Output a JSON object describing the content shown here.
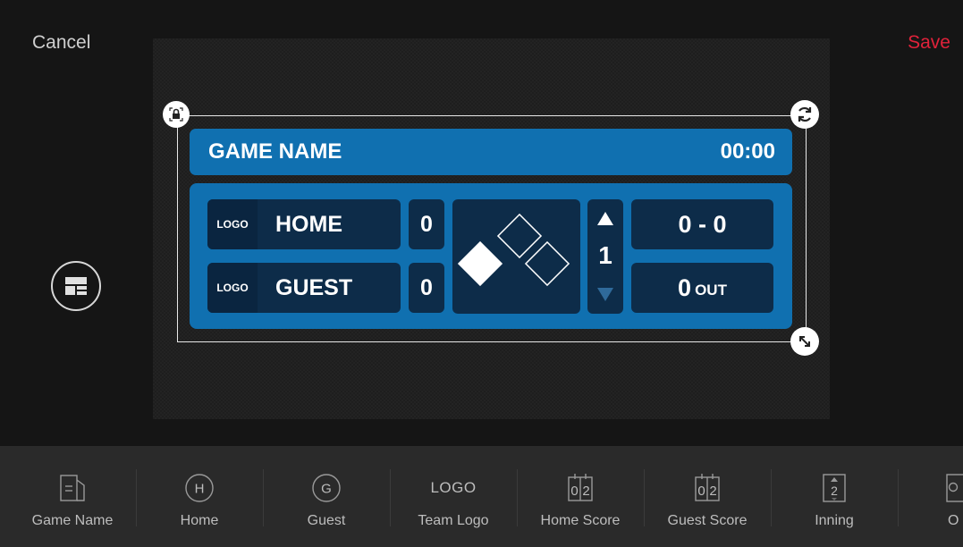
{
  "header": {
    "cancel_label": "Cancel",
    "save_label": "Save"
  },
  "scoreboard": {
    "game_name": "GAME NAME",
    "clock": "00:00",
    "home": {
      "logo": "LOGO",
      "name": "HOME",
      "score": "0"
    },
    "guest": {
      "logo": "LOGO",
      "name": "GUEST",
      "score": "0"
    },
    "inning": "1",
    "count": "0 - 0",
    "outs": "0",
    "outs_label": "OUT",
    "bases": {
      "first": false,
      "second": false,
      "third": true
    }
  },
  "handles": [
    "lock-icon",
    "rotate-icon",
    "resize-icon"
  ],
  "toolbar": {
    "items": [
      {
        "label": "Game Name",
        "icon": "game-name-icon"
      },
      {
        "label": "Home",
        "icon": "home-circle-icon",
        "glyph": "H"
      },
      {
        "label": "Guest",
        "icon": "guest-circle-icon",
        "glyph": "G"
      },
      {
        "label": "Team Logo",
        "icon": "team-logo-icon",
        "glyph": "LOGO"
      },
      {
        "label": "Home Score",
        "icon": "home-score-icon",
        "glyph": "0|2"
      },
      {
        "label": "Guest Score",
        "icon": "guest-score-icon",
        "glyph": "0|2"
      },
      {
        "label": "Inning",
        "icon": "inning-icon",
        "glyph": "2"
      },
      {
        "label": "O",
        "icon": "outs-icon"
      }
    ]
  },
  "colors": {
    "accent": "#e0223a",
    "panel_blue": "#1070b0",
    "dark_cell": "#0d2c49"
  }
}
